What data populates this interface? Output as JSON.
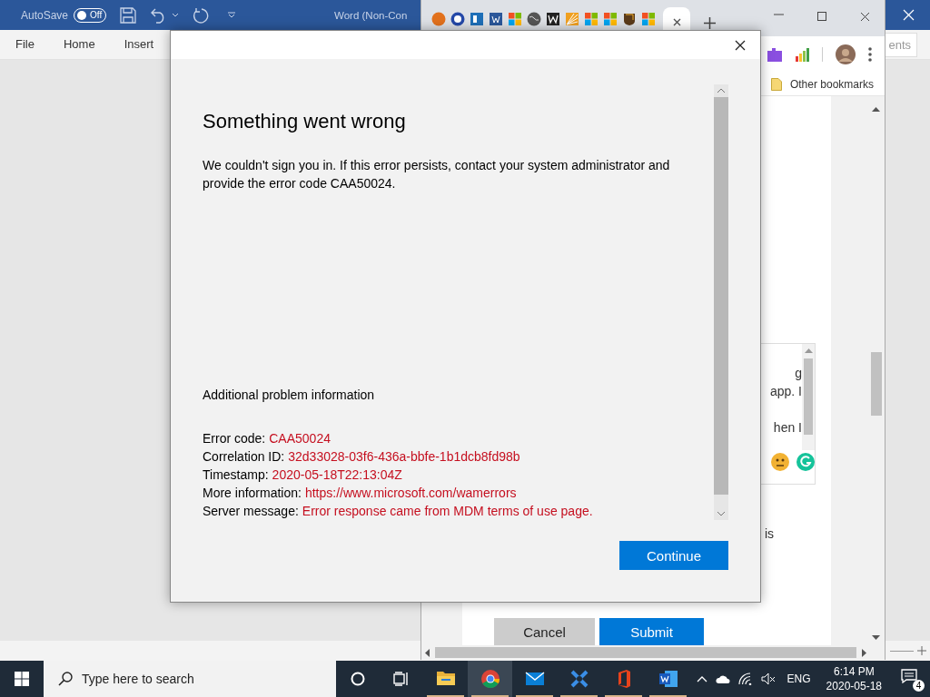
{
  "word": {
    "autosave_label": "AutoSave",
    "autosave_toggle": {
      "label": "Off",
      "on": false
    },
    "title": "Word (Non-Con",
    "ribbon_tabs": [
      {
        "label": "File",
        "selected": false
      },
      {
        "label": "Home",
        "selected": false
      },
      {
        "label": "Insert",
        "selected": false
      }
    ],
    "comments_button": "ents"
  },
  "browser": {
    "bookmarks": [
      {
        "label": "Other bookmarks"
      }
    ],
    "page": {
      "chat_fragments": [
        "g",
        "app. I",
        "hen I"
      ],
      "text_fragment": "is",
      "buttons": [
        {
          "label": "Cancel",
          "kind": "secondary"
        },
        {
          "label": "Submit",
          "kind": "primary"
        }
      ]
    }
  },
  "dialog": {
    "title": "Something went wrong",
    "message": "We couldn't sign you in. If this error persists, contact your system administrator and provide the error code CAA50024.",
    "section_title": "Additional problem information",
    "details": [
      {
        "label": "Error code:",
        "value": "CAA50024"
      },
      {
        "label": "Correlation ID:",
        "value": "32d33028-03f6-436a-bbfe-1b1dcb8fd98b"
      },
      {
        "label": "Timestamp:",
        "value": "2020-05-18T22:13:04Z"
      },
      {
        "label": "More information:",
        "value": "https://www.microsoft.com/wamerrors"
      },
      {
        "label": "Server message:",
        "value": "Error response came from MDM terms of use page."
      }
    ],
    "buttons": [
      {
        "label": "Continue",
        "kind": "primary"
      }
    ]
  },
  "taskbar": {
    "search": {
      "placeholder": "Type here to search"
    },
    "apps": [
      {
        "kind": "folder",
        "selected": false,
        "running": true
      },
      {
        "kind": "browser",
        "selected": true,
        "running": true
      },
      {
        "kind": "mail",
        "selected": false,
        "running": true
      },
      {
        "kind": "tools",
        "selected": false,
        "running": true
      },
      {
        "kind": "office",
        "selected": false,
        "running": true
      },
      {
        "kind": "word",
        "selected": false,
        "running": true
      }
    ],
    "tray": {
      "language": "ENG",
      "time": "6:14 PM",
      "date": "2020-05-18",
      "notification_count": "4"
    }
  }
}
